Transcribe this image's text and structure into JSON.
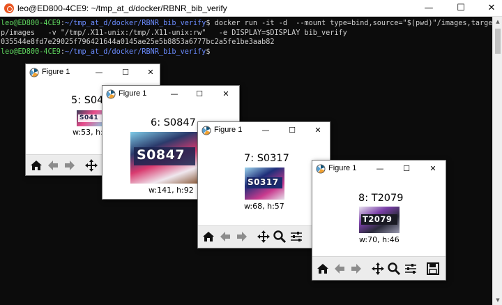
{
  "terminal": {
    "title": "leo@ED800-4CE9: ~/tmp_at_d/docker/RBNR_bib_verify",
    "controls": {
      "minimize": "—",
      "maximize": "☐",
      "close": "✕"
    },
    "lines": [
      {
        "user": "leo@ED800-4CE9",
        "sep": ":",
        "path": "~/tmp_at_d/docker/RBNR_bib_verify",
        "cmd": "$ docker run -it -d  --mount type=bind,source=\"$(pwd)\"/images,target=/ap"
      },
      {
        "text": "p/images   -v \"/tmp/.X11-unix:/tmp/.X11-unix:rw\"   -e DISPLAY=$DISPLAY bib_verify"
      },
      {
        "text": "035544e8fd7e29025f796421644a0145ae25e5b8853a6777bc2a5fe1be3aab82"
      },
      {
        "user": "leo@ED800-4CE9",
        "sep": ":",
        "path": "~/tmp_at_d/docker/RBNR_bib_verify",
        "cmd": "$ "
      }
    ]
  },
  "figures": [
    {
      "window_title": "Figure 1",
      "plot_title": "5: S04",
      "caption": "w:53, h:",
      "image_text": "S041",
      "image_colors": [
        "#3c3c5a",
        "#e84b8a",
        "#8ad1e8"
      ]
    },
    {
      "window_title": "Figure 1",
      "plot_title": "6: S0847",
      "caption": "w:141, h:92",
      "image_text": "S0847",
      "image_colors": [
        "#2b3a6b",
        "#d93a6f",
        "#7fcbe8"
      ]
    },
    {
      "window_title": "Figure 1",
      "plot_title": "7: S0317",
      "caption": "w:68, h:57",
      "image_text": "S0317",
      "image_colors": [
        "#1f2f7a",
        "#c83a8e",
        "#9fd6ef"
      ]
    },
    {
      "window_title": "Figure 1",
      "plot_title": "8: T2079",
      "caption": "w:70, h:46",
      "image_text": "T2079",
      "image_colors": [
        "#2a2a3a",
        "#7a3fa8",
        "#e8e0f0"
      ]
    }
  ],
  "toolbar_icons": [
    "home-icon",
    "back-arrow-icon",
    "forward-arrow-icon",
    "pan-icon",
    "zoom-icon",
    "configure-subplots-icon",
    "save-icon"
  ]
}
